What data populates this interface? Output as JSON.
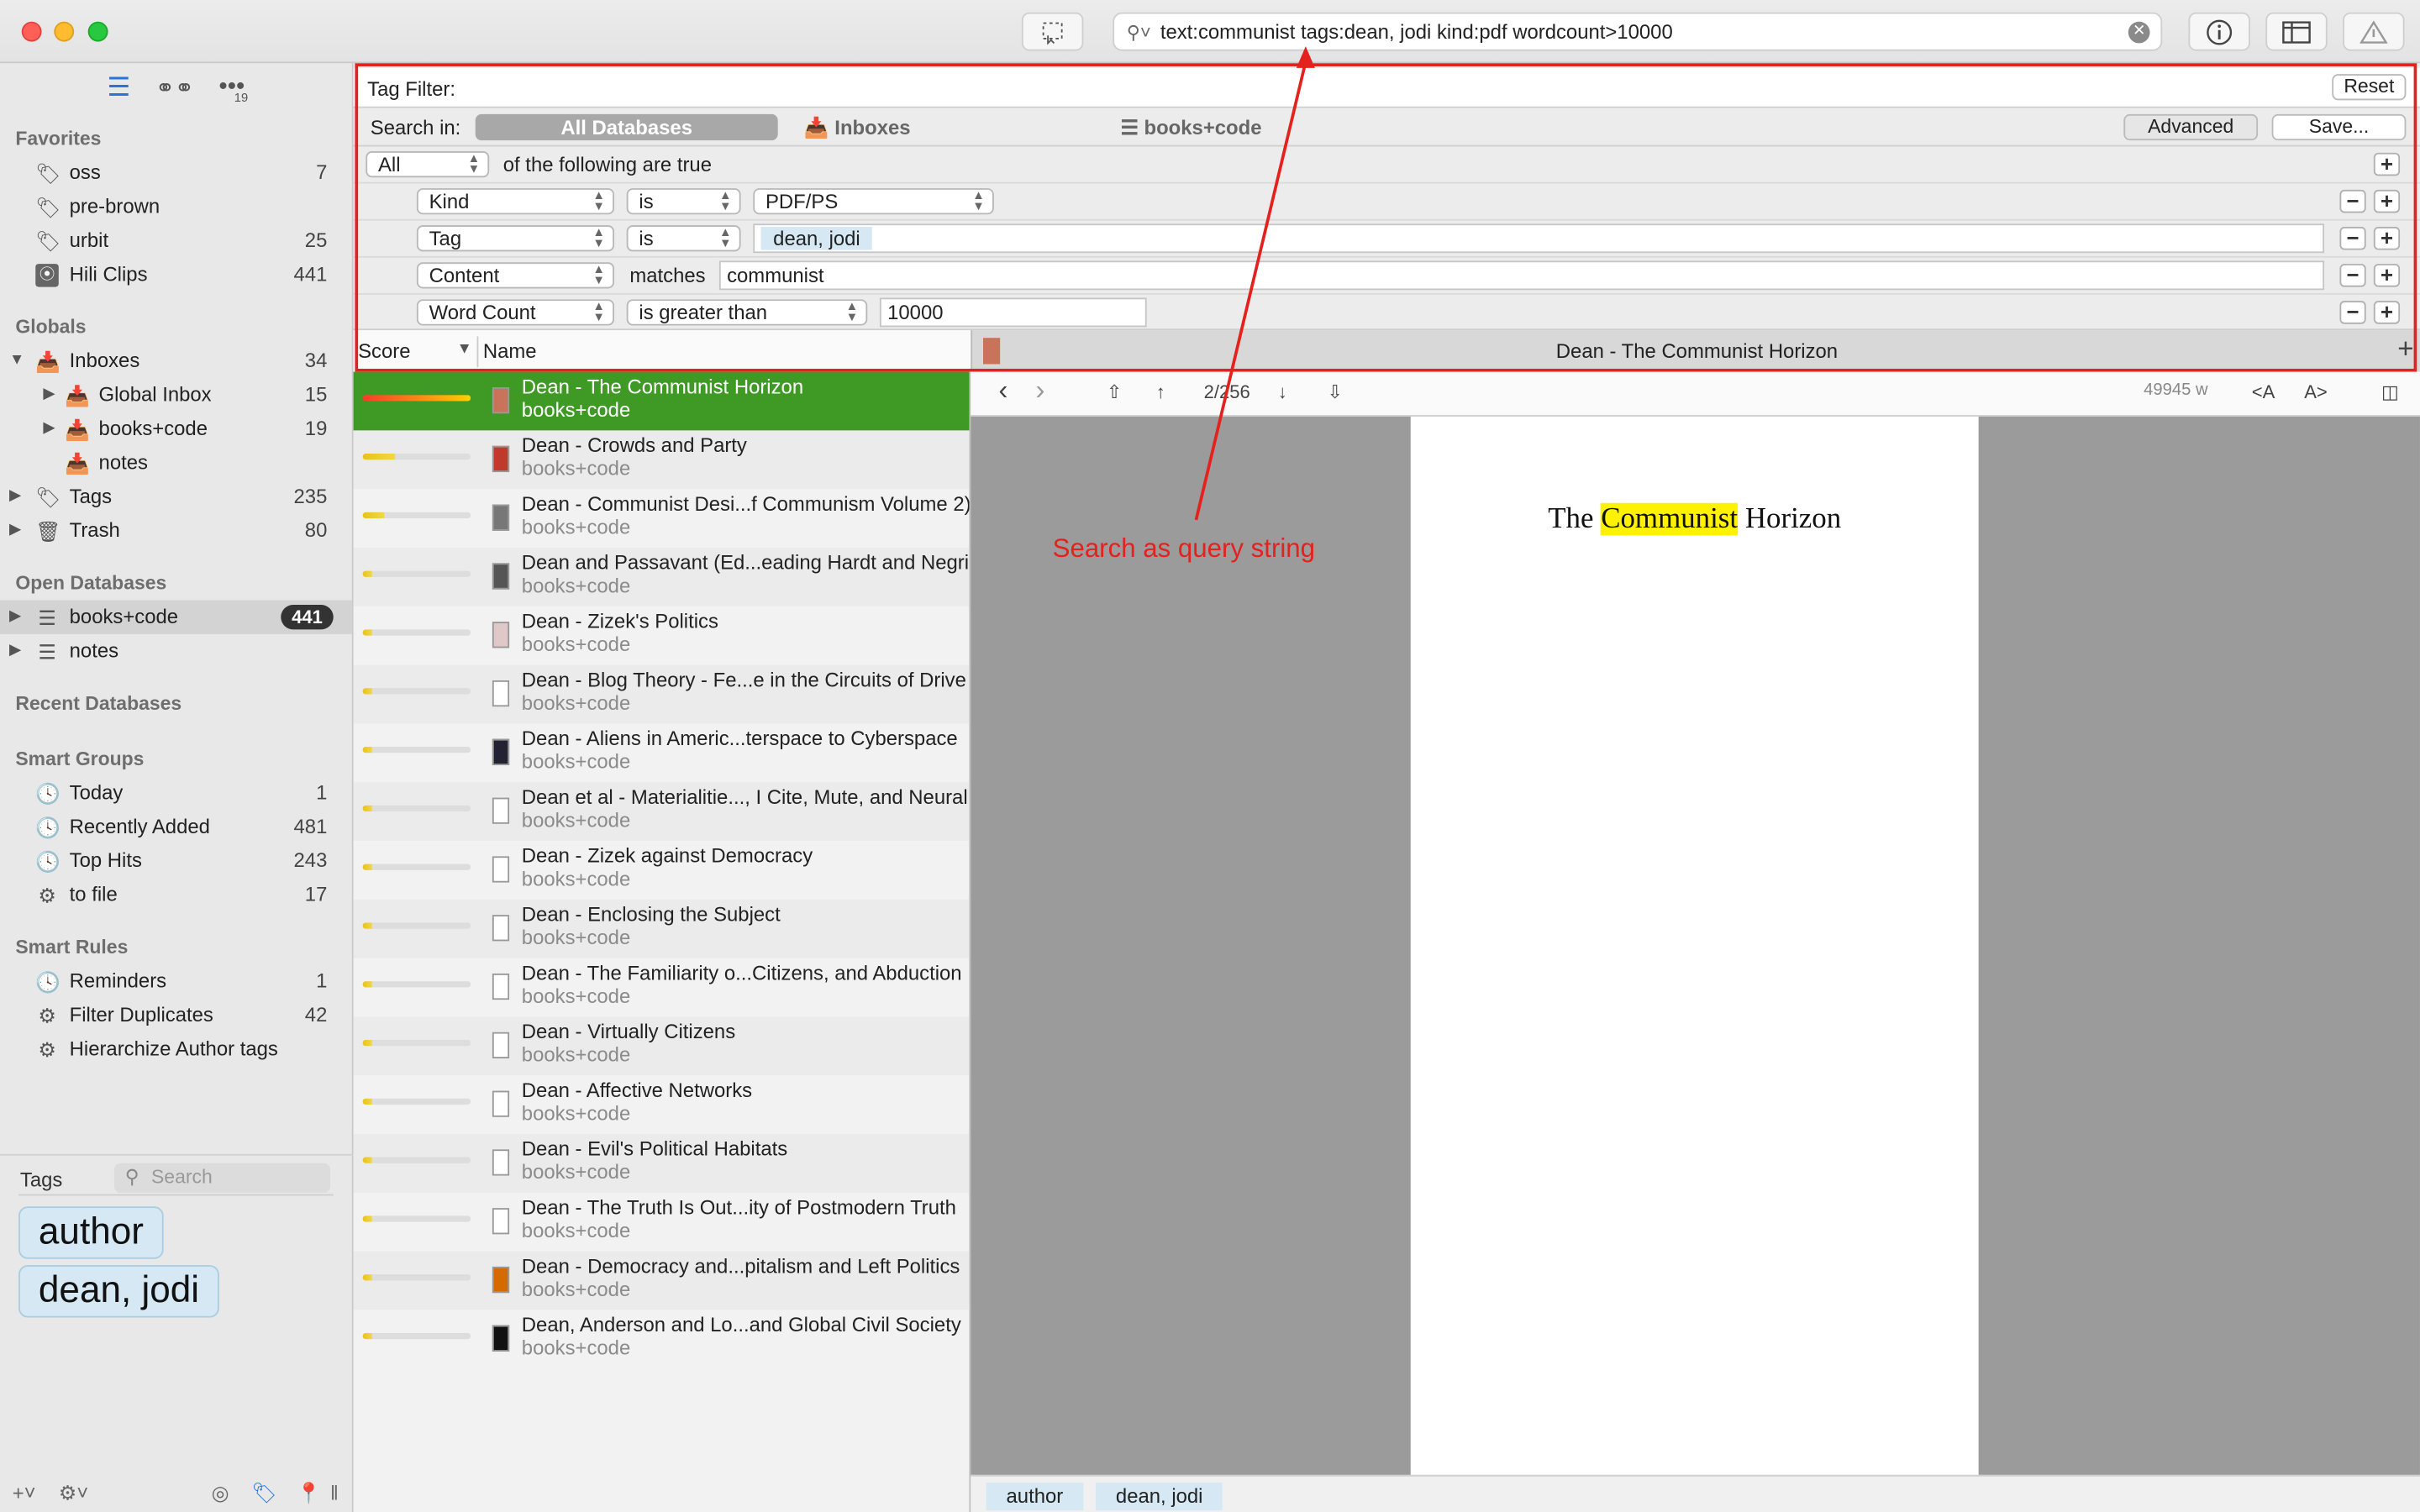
{
  "toolbar": {
    "search_query": "text:communist tags:dean, jodi kind:pdf wordcount>10000"
  },
  "sidebar": {
    "tab_badge": "19",
    "favorites_label": "Favorites",
    "favorites": [
      {
        "label": "oss",
        "count": "7",
        "icon": "tag-icon"
      },
      {
        "label": "pre-brown",
        "count": "",
        "icon": "tag-icon"
      },
      {
        "label": "urbit",
        "count": "25",
        "icon": "tag-icon"
      },
      {
        "label": "Hili Clips",
        "count": "441",
        "icon": "rss-icon"
      }
    ],
    "globals_label": "Globals",
    "globals": [
      {
        "label": "Inboxes",
        "count": "34"
      },
      {
        "label": "Global Inbox",
        "count": "15"
      },
      {
        "label": "books+code",
        "count": "19"
      },
      {
        "label": "notes",
        "count": ""
      },
      {
        "label": "Tags",
        "count": "235"
      },
      {
        "label": "Trash",
        "count": "80"
      }
    ],
    "open_db_label": "Open Databases",
    "open_dbs": [
      {
        "label": "books+code",
        "count": "441"
      },
      {
        "label": "notes",
        "count": ""
      }
    ],
    "recent_label": "Recent Databases",
    "smart_groups_label": "Smart Groups",
    "smart_groups": [
      {
        "label": "Today",
        "count": "1"
      },
      {
        "label": "Recently Added",
        "count": "481"
      },
      {
        "label": "Top Hits",
        "count": "243"
      },
      {
        "label": "to file",
        "count": "17"
      }
    ],
    "smart_rules_label": "Smart Rules",
    "smart_rules": [
      {
        "label": "Reminders",
        "count": "1"
      },
      {
        "label": "Filter Duplicates",
        "count": "42"
      },
      {
        "label": "Hierarchize Author tags",
        "count": ""
      }
    ],
    "tags_label": "Tags",
    "tags_search_placeholder": "Search",
    "tags": [
      "author",
      "dean, jodi"
    ]
  },
  "filter": {
    "tag_filter_label": "Tag Filter:",
    "reset_label": "Reset",
    "search_in_label": "Search in:",
    "scope_all": "All Databases",
    "scope_inboxes": "Inboxes",
    "scope_db": "books+code",
    "advanced_label": "Advanced",
    "save_label": "Save...",
    "match_mode": "All",
    "match_suffix": "of the following are true",
    "criteria": [
      {
        "field": "Kind",
        "op": "is",
        "value": "PDF/PS"
      },
      {
        "field": "Tag",
        "op": "is",
        "value": "dean, jodi"
      },
      {
        "field": "Content",
        "op": "matches",
        "value": "communist"
      },
      {
        "field": "Word Count",
        "op": "is greater than",
        "value": "10000"
      }
    ]
  },
  "columns": {
    "score": "Score",
    "name": "Name"
  },
  "results": [
    {
      "name": "Dean - The Communist Horizon",
      "db": "books+code",
      "score": 1.0
    },
    {
      "name": "Dean - Crowds and Party",
      "db": "books+code",
      "score": 0.3
    },
    {
      "name": "Dean - Communist Desi...f Communism Volume 2)",
      "db": "books+code",
      "score": 0.2
    },
    {
      "name": "Dean and Passavant (Ed...eading Hardt and Negri",
      "db": "books+code",
      "score": 0.08
    },
    {
      "name": "Dean - Zizek's Politics",
      "db": "books+code",
      "score": 0.08
    },
    {
      "name": "Dean - Blog Theory - Fe...e in the Circuits of Drive",
      "db": "books+code",
      "score": 0.08
    },
    {
      "name": "Dean - Aliens in Americ...terspace to Cyberspace",
      "db": "books+code",
      "score": 0.08
    },
    {
      "name": "Dean et al - Materialitie..., I Cite, Mute, and Neural",
      "db": "books+code",
      "score": 0.08
    },
    {
      "name": "Dean - Zizek against Democracy",
      "db": "books+code",
      "score": 0.08
    },
    {
      "name": "Dean - Enclosing the Subject",
      "db": "books+code",
      "score": 0.08
    },
    {
      "name": "Dean - The Familiarity o...Citizens, and Abduction",
      "db": "books+code",
      "score": 0.08
    },
    {
      "name": "Dean - Virtually Citizens",
      "db": "books+code",
      "score": 0.08
    },
    {
      "name": "Dean - Affective Networks",
      "db": "books+code",
      "score": 0.08
    },
    {
      "name": "Dean - Evil's Political Habitats",
      "db": "books+code",
      "score": 0.08
    },
    {
      "name": "Dean - The Truth Is Out...ity of Postmodern Truth",
      "db": "books+code",
      "score": 0.08
    },
    {
      "name": "Dean - Democracy and...pitalism and Left Politics",
      "db": "books+code",
      "score": 0.08
    },
    {
      "name": "Dean, Anderson and Lo...and Global Civil Society",
      "db": "books+code",
      "score": 0.08
    }
  ],
  "viewer": {
    "title": "Dean - The Communist Horizon",
    "page_indicator": "2/256",
    "word_count": "49945 w",
    "page_title_pre": "The ",
    "page_title_hl": "Communist",
    "page_title_post": " Horizon",
    "tags": [
      "author",
      "dean, jodi"
    ]
  },
  "annotation": "Search as query string"
}
